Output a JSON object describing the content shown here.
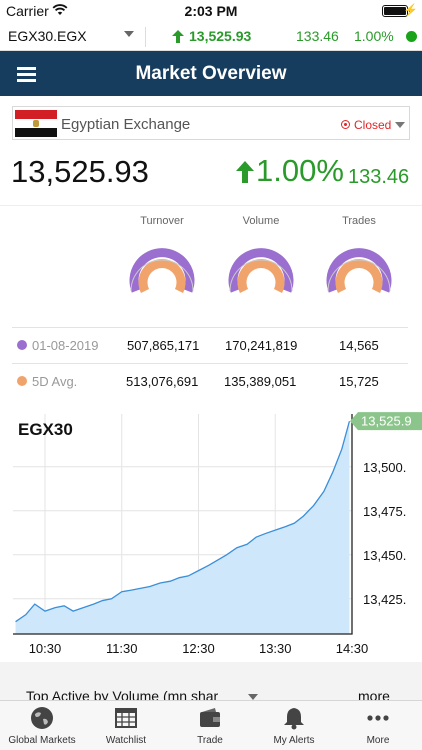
{
  "status_bar": {
    "carrier": "Carrier",
    "time": "2:03 PM"
  },
  "ticker": {
    "symbol": "EGX30.EGX",
    "last": "13,525.93",
    "change": "133.46",
    "pct": "1.00%"
  },
  "nav": {
    "title": "Market Overview"
  },
  "exchange": {
    "name": "Egyptian Exchange",
    "status": "Closed"
  },
  "index": {
    "value": "13,525.93",
    "pct_change": "1.00%",
    "pts_change": "133.46"
  },
  "gauges": [
    {
      "label": "Turnover"
    },
    {
      "label": "Volume"
    },
    {
      "label": "Trades"
    }
  ],
  "stats": [
    {
      "label": "01-08-2019",
      "turnover": "507,865,171",
      "volume": "170,241,819",
      "trades": "14,565",
      "color": "#9b6fd0"
    },
    {
      "label": "5D Avg.",
      "turnover": "513,076,691",
      "volume": "135,389,051",
      "trades": "15,725",
      "color": "#f0a46b"
    }
  ],
  "colors": {
    "up": "#2a9a2a",
    "navy": "#173d5e",
    "closed": "#e0262a",
    "area": "#cfe7fb",
    "line": "#3b8fd8",
    "last_tag": "#8bc58b"
  },
  "chart_data": {
    "type": "area",
    "title": "EGX30",
    "x_ticks": [
      "10:30",
      "11:30",
      "12:30",
      "13:30",
      "14:30"
    ],
    "y_ticks": [
      "13,500.",
      "13,475.",
      "13,450.",
      "13,425."
    ],
    "last_label": "13,525.9",
    "x": [
      "10:07",
      "10:15",
      "10:22",
      "10:30",
      "10:38",
      "10:45",
      "10:52",
      "11:00",
      "11:08",
      "11:15",
      "11:22",
      "11:30",
      "11:38",
      "11:45",
      "11:52",
      "12:00",
      "12:08",
      "12:15",
      "12:22",
      "12:30",
      "12:38",
      "12:45",
      "12:52",
      "13:00",
      "13:08",
      "13:15",
      "13:22",
      "13:30",
      "13:38",
      "13:45",
      "13:52",
      "14:00",
      "14:08",
      "14:15",
      "14:22",
      "14:28"
    ],
    "y": [
      13412,
      13416,
      13422,
      13418,
      13420,
      13421,
      13418,
      13420,
      13422,
      13424,
      13425,
      13429,
      13430,
      13431,
      13432,
      13434,
      13435,
      13437,
      13438,
      13441,
      13444,
      13447,
      13450,
      13454,
      13456,
      13460,
      13462,
      13464,
      13466,
      13468,
      13472,
      13478,
      13486,
      13497,
      13510,
      13525.93
    ],
    "ylim": [
      13405,
      13530
    ],
    "grid": true
  },
  "lower": {
    "heading": "Top Active by Volume (mn shar",
    "more": "more"
  },
  "tabs": [
    {
      "label": "Global Markets",
      "icon": "globe-icon"
    },
    {
      "label": "Watchlist",
      "icon": "watchlist-icon"
    },
    {
      "label": "Trade",
      "icon": "wallet-icon"
    },
    {
      "label": "My Alerts",
      "icon": "bell-icon"
    },
    {
      "label": "More",
      "icon": "more-dots-icon"
    }
  ]
}
